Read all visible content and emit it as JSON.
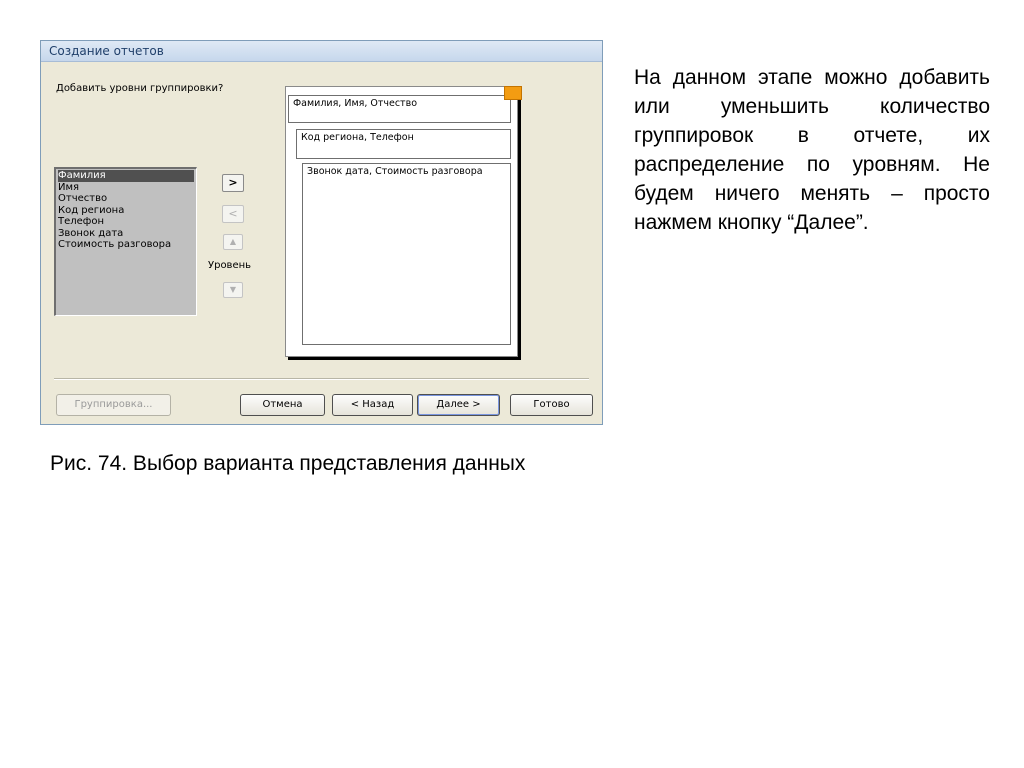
{
  "dialog": {
    "title": "Создание отчетов",
    "question": "Добавить уровни группировки?",
    "fields": [
      "Фамилия",
      "Имя",
      "Отчество",
      "Код региона",
      "Телефон",
      "Звонок дата",
      "Стоимость разговора"
    ],
    "selected_field": "Фамилия",
    "add_label": ">",
    "remove_label": "<",
    "up_label": "▲",
    "down_label": "▼",
    "level_label": "Уровень",
    "preview": {
      "level1": "Фамилия, Имя, Отчество",
      "level2": "Код региона, Телефон",
      "detail": "Звонок дата, Стоимость разговора"
    },
    "buttons": {
      "grouping": "Группировка...",
      "cancel": "Отмена",
      "back": "< Назад",
      "next": "Далее >",
      "finish": "Готово"
    }
  },
  "caption": "Рис. 74. Выбор варианта представления данных",
  "side_text": "На данном этапе можно добавить или уменьшить количество группировок в отчете, их распределение по уровням. Не будем ничего менять – просто нажмем кнопку “Далее”."
}
